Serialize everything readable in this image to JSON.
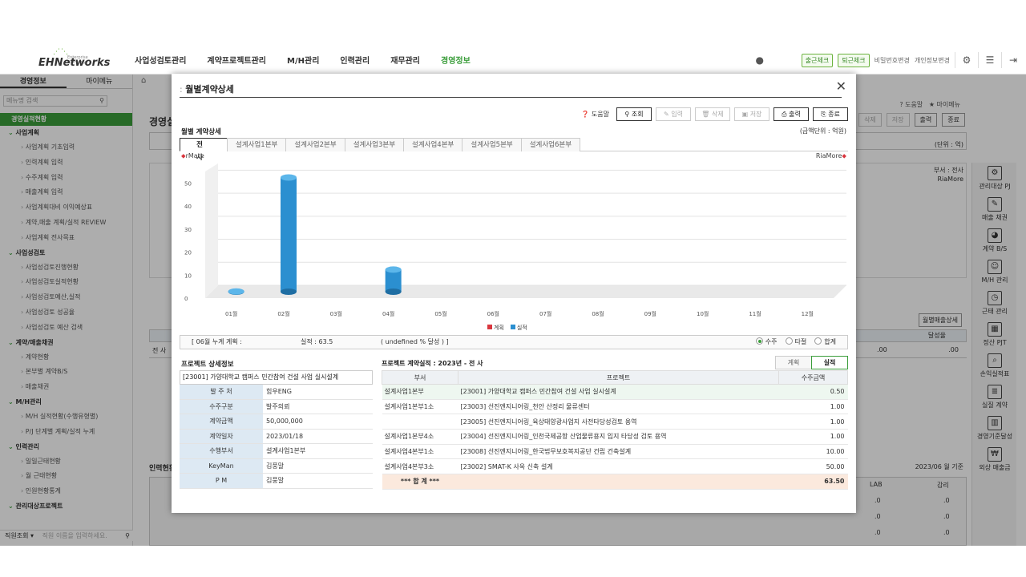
{
  "nav": {
    "logo_text": "EHNetworks",
    "logo_sub": "Enterprise Harmony",
    "menu": [
      "사업성검토관리",
      "계약프로젝트관리",
      "M/H관리",
      "인력관리",
      "재무관리",
      "경영정보"
    ],
    "checkin": "출근체크",
    "checkout": "퇴근체크",
    "pw_change": "비밀번호변경",
    "info_change": "개인정보변경"
  },
  "sidebar": {
    "tab1": "경영정보",
    "tab2": "마이메뉴",
    "search_placeholder": "메뉴명 검색",
    "current": "경영실적현황",
    "groups": [
      {
        "label": "사업계획",
        "items": [
          "사업계획 기초입력",
          "인력계획 입력",
          "수주계획 입력",
          "매출계획 입력",
          "사업계획대비 이익예상표",
          "계약,매출 계획/실적 REVIEW",
          "사업계획 전사목표"
        ]
      },
      {
        "label": "사업성검토",
        "items": [
          "사업성검토진행현황",
          "사업성검토실적현황",
          "사업성검토예산,실적",
          "사업성검토 성공율",
          "사업성검토 예산 검색"
        ]
      },
      {
        "label": "계약/매출채권",
        "items": [
          "계약현황",
          "본부별 계약B/S",
          "매출채권"
        ]
      },
      {
        "label": "M/H관리",
        "items": [
          "M/H 실적현황(수행유형별)",
          "P/J 단계별 계획/실적 누계"
        ]
      },
      {
        "label": "인력관리",
        "items": [
          "일일근태현황",
          "월 근태현황",
          "인원현황통계"
        ]
      },
      {
        "label": "관리대상프로젝트",
        "items": []
      }
    ],
    "footer_label": "직원조회",
    "footer_placeholder": "직원 이름을 입력하세요."
  },
  "background": {
    "title": "경영실",
    "help": "도움말",
    "mymenu": "마이메뉴",
    "btn_delete": "삭제",
    "btn_save": "저장",
    "btn_print": "출력",
    "btn_close": "종료",
    "unit": "(단위 : 억)",
    "dept": "부서 : 전사",
    "riamore": "RiaMore",
    "monthly_btn": "월별매출상세",
    "rate_header": "달성율",
    "row_label": "전 사",
    "row_val1": ".00",
    "row_val2": ".00",
    "people_title": "인력현황",
    "date_basis": "2023/06 월 기준",
    "col_lab": "LAB",
    "col_gamri": "감리",
    "zero": ".0"
  },
  "rail": [
    {
      "label": "관리대상 PJ",
      "icon": "doc-gear-icon"
    },
    {
      "label": "매출 채권",
      "icon": "receivable-icon"
    },
    {
      "label": "계약 B/S",
      "icon": "pie-icon"
    },
    {
      "label": "M/H 관리",
      "icon": "people-icon"
    },
    {
      "label": "근태 관리",
      "icon": "calendar-icon"
    },
    {
      "label": "정산 PJT",
      "icon": "calculator-icon"
    },
    {
      "label": "손익실적표",
      "icon": "chart-search-icon"
    },
    {
      "label": "실질 계약",
      "icon": "doc-chart-icon"
    },
    {
      "label": "경영기준달성",
      "icon": "bar-chart-icon"
    },
    {
      "label": "외상 매출금",
      "icon": "money-icon"
    }
  ],
  "modal": {
    "title": "월별계약상세",
    "help": "도움말",
    "btn_search": "조회",
    "btn_input": "입력",
    "btn_delete": "삭제",
    "btn_save": "저장",
    "btn_print": "출력",
    "btn_close": "종료",
    "section_title": "월별 계약상세",
    "unit": "(금액단위 : 억원)",
    "tabs": [
      "전 사",
      "설계사업1본부",
      "설계사업2본부",
      "설계사업3본부",
      "설계사업4본부",
      "설계사업5본부",
      "설계사업6본부"
    ],
    "rmate": "rMate",
    "riamore": "RiaMore",
    "summary_plan": "[ 06월 누계 계획 :",
    "summary_plan_close": "]",
    "summary_actual": "실적 : 63.5",
    "summary_rate": "( undefined % 달성 ) ]",
    "radios": [
      "수주",
      "타절",
      "합계"
    ],
    "detail_title": "프로젝트 상세정보",
    "detail_project": "[23001] 가양대학교 캠퍼스 민간참여 건설 사업 실시설계",
    "detail_rows": [
      {
        "k": "발 주 처",
        "v": "힘우ENG"
      },
      {
        "k": "수주구분",
        "v": "발주의뢰"
      },
      {
        "k": "계약금액",
        "v": "50,000,000"
      },
      {
        "k": "계약일자",
        "v": "2023/01/18"
      },
      {
        "k": "수행부서",
        "v": "설계사업1본부"
      },
      {
        "k": "KeyMan",
        "v": "김풍말"
      },
      {
        "k": "P M",
        "v": "김풍말"
      }
    ],
    "contract_title": "프로젝트 계약실적 : 2023년 - 전 사",
    "plan_tab": "계획",
    "actual_tab": "실적",
    "table_headers": [
      "부서",
      "프로젝트",
      "수주금액"
    ],
    "table_rows": [
      {
        "dept": "설계사업1본부",
        "project": "[23001] 가양대학교 캠퍼스 민간참여 건설 사업 실시설계",
        "amount": "0.50"
      },
      {
        "dept": "설계사업1본부1소",
        "project": "[23003] 선진엔지니어링_천안 산정리 물류센터",
        "amount": "1.00"
      },
      {
        "dept": "",
        "project": "[23005] 선진엔지니어링_육상태양광사업지 사전타당성검토 용역",
        "amount": "1.00"
      },
      {
        "dept": "설계사업1본부4소",
        "project": "[23004] 선진엔지니어링_인천국제공항 산업물류용지 입지 타당성 검토 용역",
        "amount": "1.00"
      },
      {
        "dept": "설계사업4본부1소",
        "project": "[23008] 선진엔지니어링_한국법무보호복지공단 건립 건축설계",
        "amount": "10.00"
      },
      {
        "dept": "설계사업4본부3소",
        "project": "[23002] SMAT-K 사옥 신축 설계",
        "amount": "50.00"
      }
    ],
    "total_label": "*** 합 계 ***",
    "total_amount": "63.50",
    "legend": [
      "계획",
      "실적"
    ]
  },
  "chart_data": {
    "type": "bar",
    "categories": [
      "01월",
      "02월",
      "03월",
      "04월",
      "05월",
      "06월",
      "07월",
      "08월",
      "09월",
      "10월",
      "11월",
      "12월"
    ],
    "ylim": [
      0,
      50
    ],
    "yticks": [
      0,
      10,
      20,
      30,
      40,
      50
    ],
    "series": [
      {
        "name": "계획",
        "color": "#d9363e",
        "values": [
          0,
          0,
          0,
          0,
          0,
          0,
          0,
          0,
          0,
          0,
          0,
          0
        ]
      },
      {
        "name": "실적",
        "color": "#2b8fd0",
        "values": [
          1.5,
          51,
          0,
          11,
          0,
          0,
          0,
          0,
          0,
          0,
          0,
          0
        ]
      }
    ],
    "legend_position": "bottom"
  }
}
